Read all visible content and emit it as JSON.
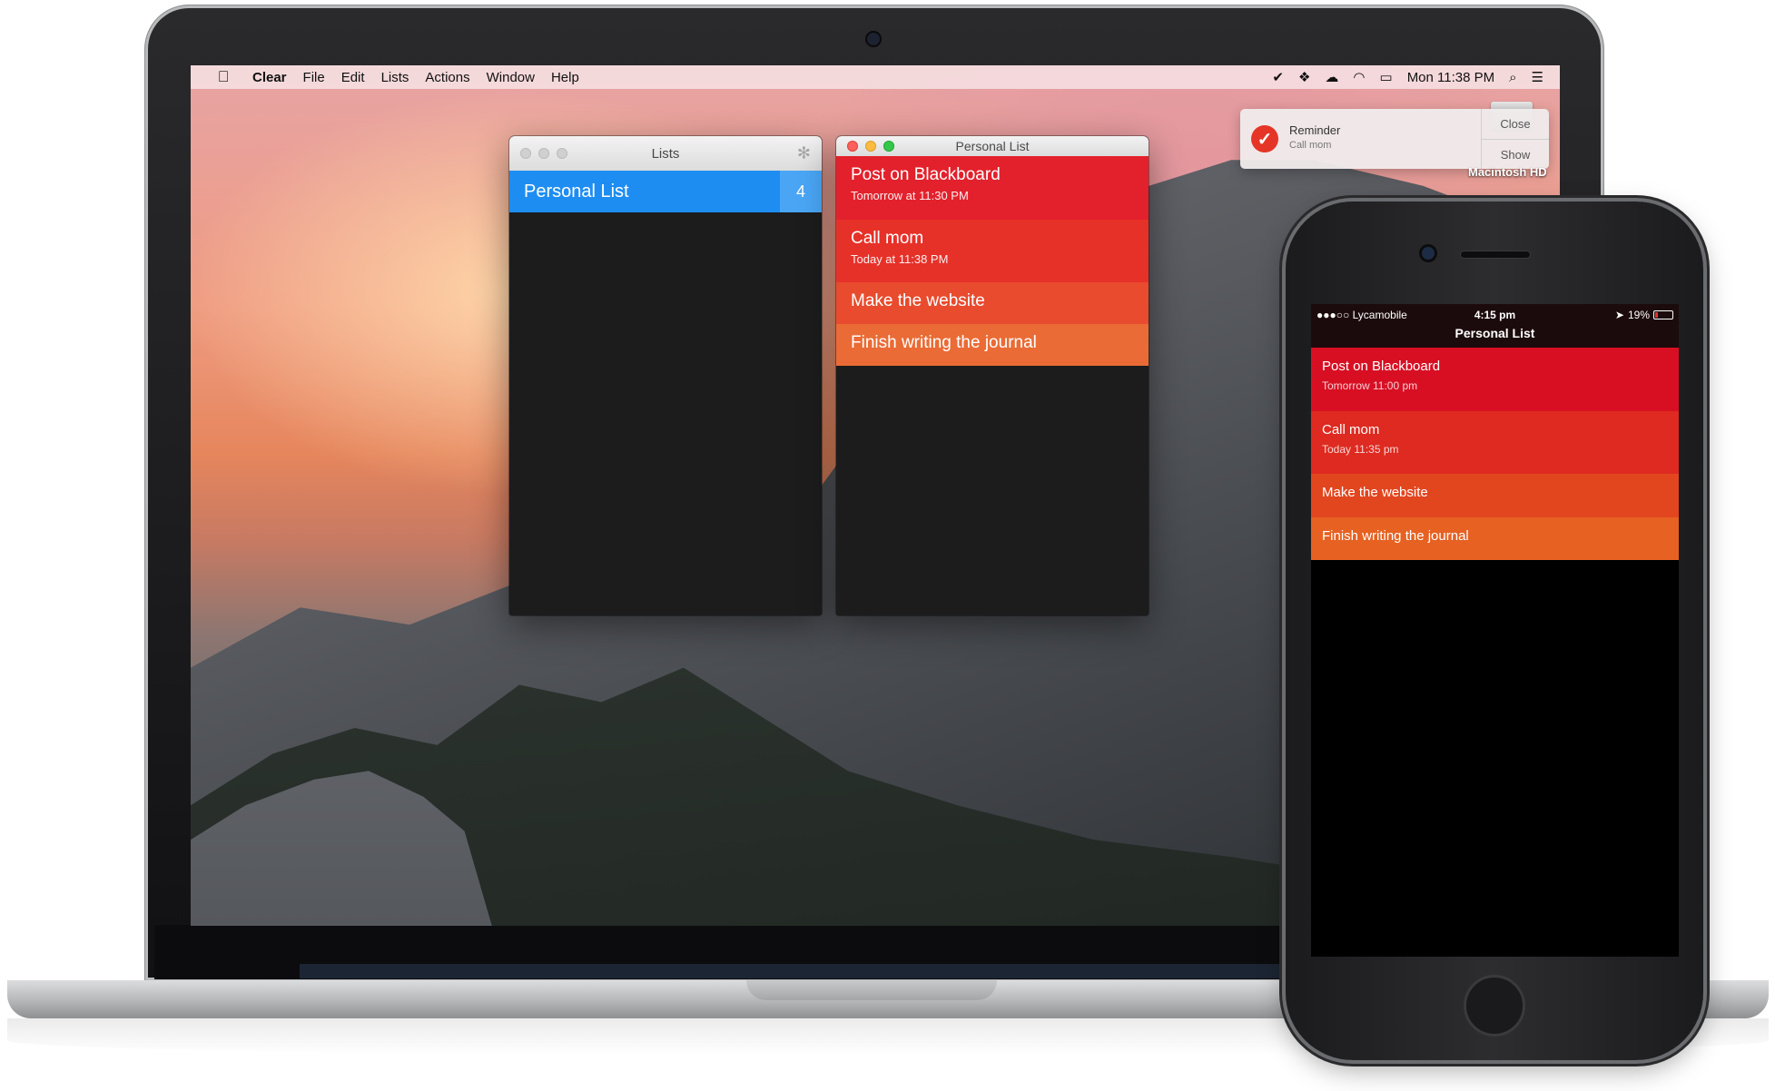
{
  "menubar": {
    "apple_icon": "apple-icon",
    "app_name": "Clear",
    "menus": [
      "File",
      "Edit",
      "Lists",
      "Actions",
      "Window",
      "Help"
    ],
    "clock": "Mon 11:38 PM"
  },
  "lists_window": {
    "title": "Lists",
    "items": [
      {
        "label": "Personal List",
        "count": "4"
      }
    ]
  },
  "personal_window": {
    "title": "Personal List",
    "tasks": [
      {
        "title": "Post on Blackboard",
        "subtitle": "Tomorrow at 11:30 PM",
        "color": "#e3212c"
      },
      {
        "title": "Call mom",
        "subtitle": "Today at 11:38 PM",
        "color": "#e63129"
      },
      {
        "title": "Make the website",
        "subtitle": "",
        "color": "#e84b2d"
      },
      {
        "title": "Finish writing the journal",
        "subtitle": "",
        "color": "#ea6b35"
      }
    ]
  },
  "notification": {
    "title": "Reminder",
    "body": "Call mom",
    "close_label": "Close",
    "show_label": "Show"
  },
  "desktop": {
    "drive_label": "Macintosh HD"
  },
  "phone": {
    "carrier": "●●●○○ Lycamobile",
    "time": "4:15 pm",
    "battery": "19%",
    "battery_level": 0.19,
    "header": "Personal List",
    "tasks": [
      {
        "title": "Post on Blackboard",
        "subtitle": "Tomorrow 11:00 pm",
        "color": "#d80f23"
      },
      {
        "title": "Call mom",
        "subtitle": "Today 11:35 pm",
        "color": "#de2a21"
      },
      {
        "title": "Make the website",
        "subtitle": "",
        "color": "#e2461f"
      },
      {
        "title": "Finish writing the journal",
        "subtitle": "",
        "color": "#e66122"
      }
    ]
  }
}
